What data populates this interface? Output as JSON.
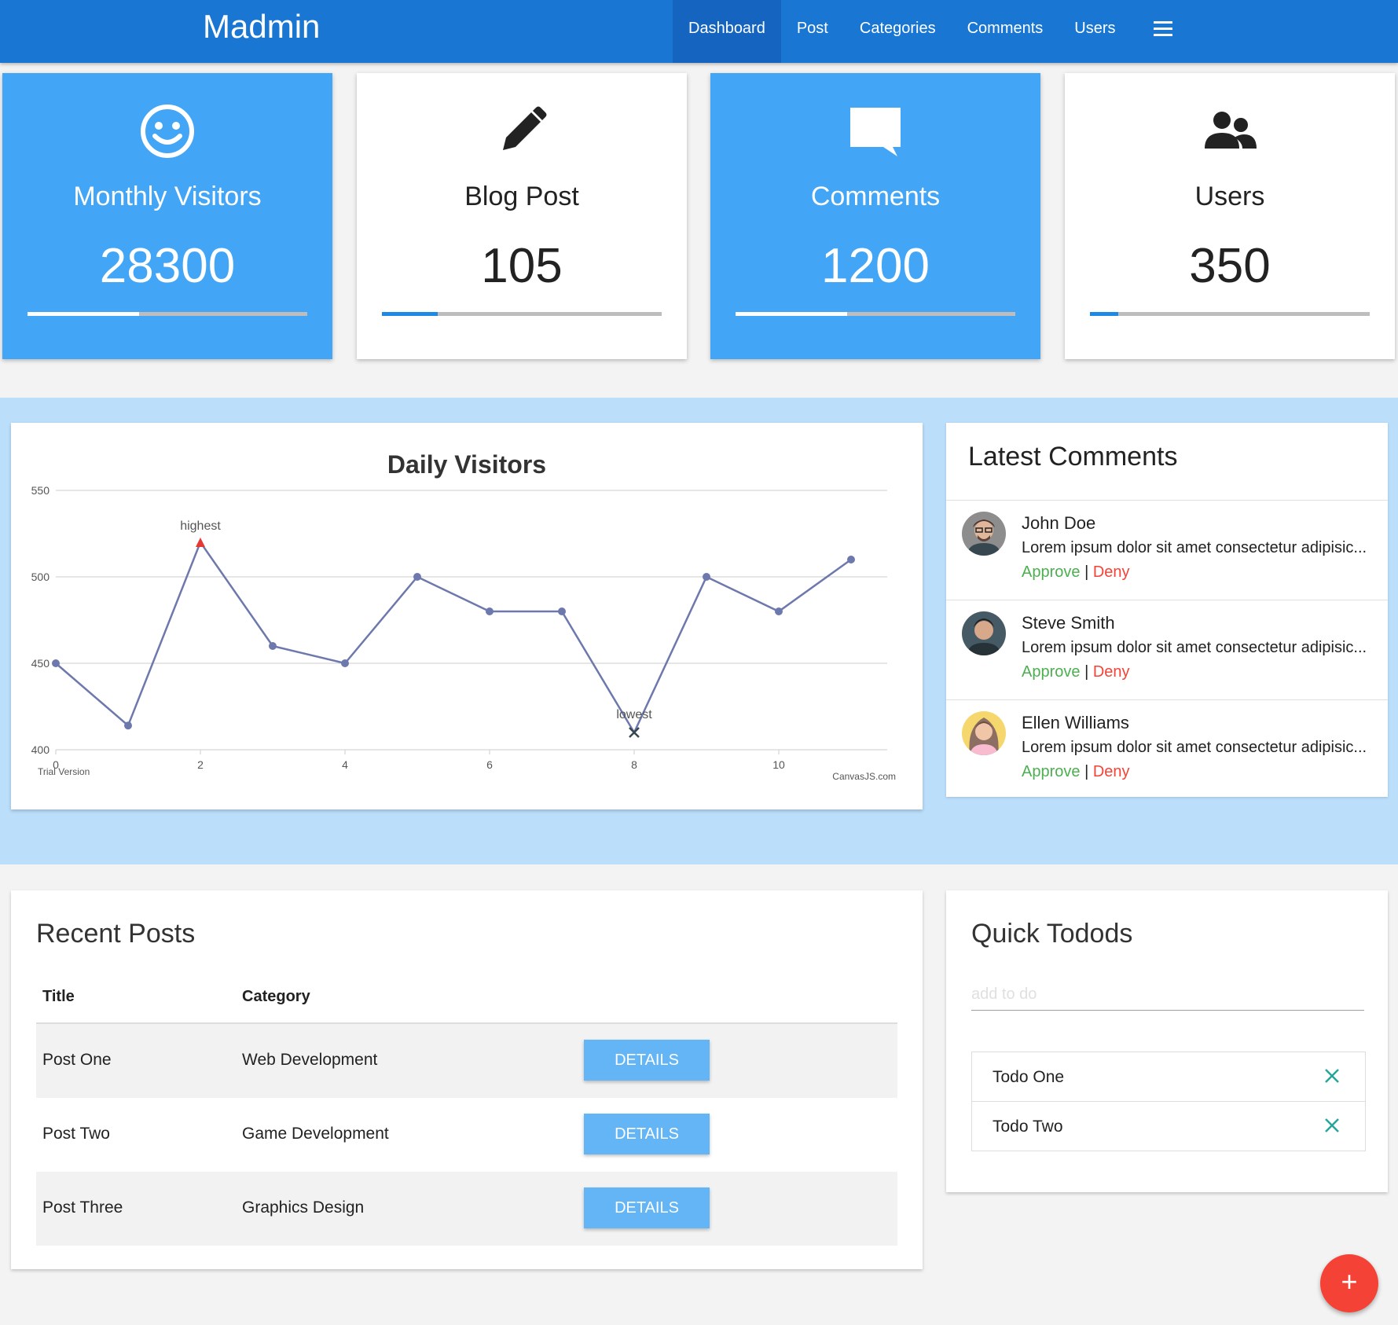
{
  "app": {
    "brand": "Madmin"
  },
  "nav": {
    "items": [
      {
        "label": "Dashboard",
        "active": true
      },
      {
        "label": "Post"
      },
      {
        "label": "Categories"
      },
      {
        "label": "Comments"
      },
      {
        "label": "Users"
      }
    ],
    "menu_icon": "hamburger-menu-icon"
  },
  "cards": [
    {
      "title": "Monthly Visitors",
      "value": "28300",
      "icon": "smiley-face-icon",
      "progress": 0.4,
      "style": "blue"
    },
    {
      "title": "Blog Post",
      "value": "105",
      "icon": "pencil-icon",
      "progress": 0.2,
      "style": "white"
    },
    {
      "title": "Comments",
      "value": "1200",
      "icon": "comment-icon",
      "progress": 0.4,
      "style": "blue"
    },
    {
      "title": "Users",
      "value": "350",
      "icon": "users-icon",
      "progress": 0.1,
      "style": "white"
    }
  ],
  "colors": {
    "primary": "#1976d2",
    "nav_active": "#1565c0",
    "accent_blue": "#42a5f5",
    "band": "#bbdefb",
    "details": "#64b5f6",
    "approve": "#4caf50",
    "deny": "#f44336",
    "fab": "#f44336",
    "line": "#6d78ad",
    "todo_x": "#26a69a"
  },
  "chart_data": {
    "type": "line",
    "title": "Daily Visitors",
    "x": [
      0,
      1,
      2,
      3,
      4,
      5,
      6,
      7,
      8,
      9,
      10,
      11
    ],
    "values": [
      450,
      414,
      520,
      460,
      450,
      500,
      480,
      480,
      410,
      500,
      480,
      510
    ],
    "ylim": [
      400,
      550
    ],
    "xlim": [
      0,
      11.5
    ],
    "yticks": [
      400,
      450,
      500,
      550
    ],
    "xticks": [
      0,
      2,
      4,
      6,
      8,
      10
    ],
    "grid": true,
    "annotations": [
      {
        "x": 2,
        "label": "highest"
      },
      {
        "x": 8,
        "label": "lowest"
      }
    ],
    "watermark_left": "Trial Version",
    "watermark_right": "CanvasJS.com"
  },
  "comments": {
    "title": "Latest Comments",
    "items": [
      {
        "name": "John Doe",
        "text": "Lorem ipsum dolor sit amet consectetur adipisic...",
        "approve": "Approve",
        "sep": "|",
        "deny": "Deny",
        "avatar": "man-glasses-avatar"
      },
      {
        "name": "Steve Smith",
        "text": "Lorem ipsum dolor sit amet consectetur adipisic...",
        "approve": "Approve",
        "sep": "|",
        "deny": "Deny",
        "avatar": "man-avatar"
      },
      {
        "name": "Ellen Williams",
        "text": "Lorem ipsum dolor sit amet consectetur adipisic...",
        "approve": "Approve",
        "sep": "|",
        "deny": "Deny",
        "avatar": "woman-avatar"
      }
    ]
  },
  "posts": {
    "title": "Recent Posts",
    "columns": [
      "Title",
      "Category"
    ],
    "rows": [
      {
        "title": "Post One",
        "category": "Web Development",
        "button": "DETAILS"
      },
      {
        "title": "Post Two",
        "category": "Game Development",
        "button": "DETAILS"
      },
      {
        "title": "Post Three",
        "category": "Graphics Design",
        "button": "DETAILS"
      }
    ]
  },
  "todos": {
    "title": "Quick Todods",
    "placeholder": "add to do",
    "items": [
      "Todo One",
      "Todo Two"
    ]
  },
  "fab": {
    "label": "+",
    "icon": "plus-icon"
  }
}
